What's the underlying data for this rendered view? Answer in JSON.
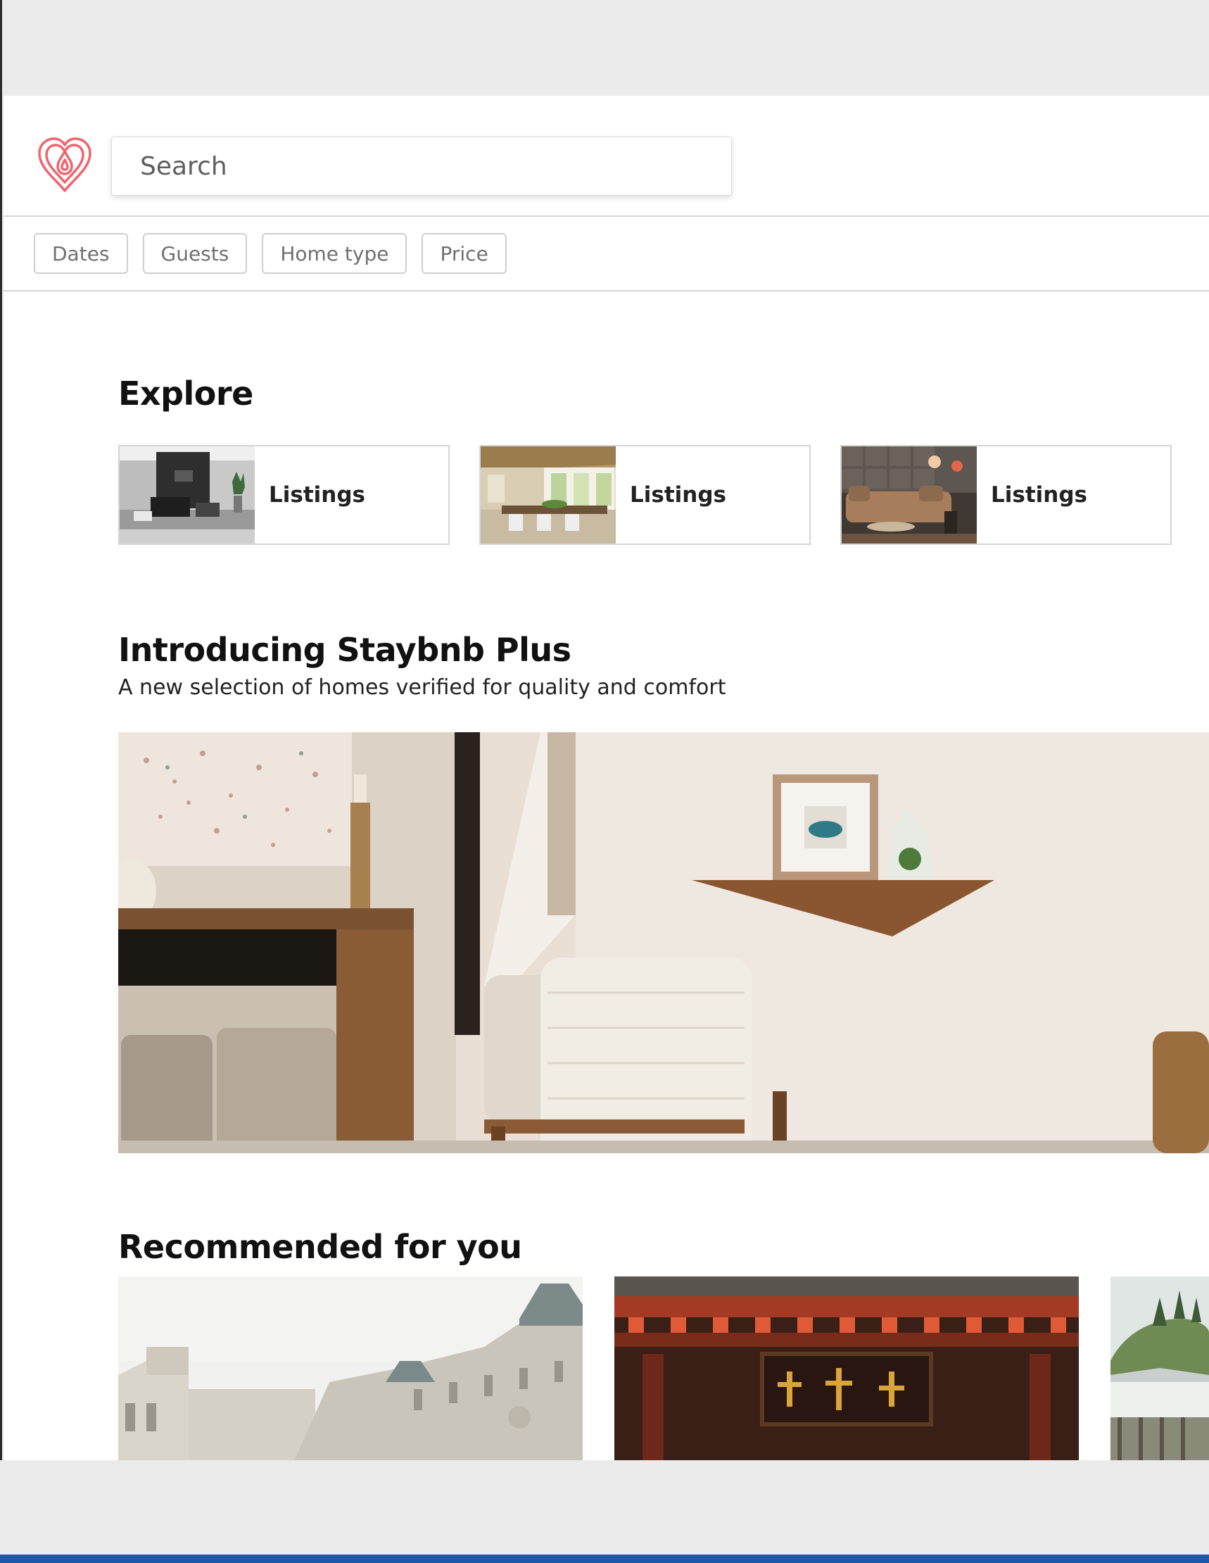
{
  "search": {
    "placeholder": "Search"
  },
  "filters": [
    {
      "label": "Dates"
    },
    {
      "label": "Guests"
    },
    {
      "label": "Home type"
    },
    {
      "label": "Price"
    }
  ],
  "explore": {
    "title": "Explore",
    "cards": [
      {
        "label": "Listings"
      },
      {
        "label": "Listings"
      },
      {
        "label": "Listings"
      }
    ]
  },
  "plus": {
    "title": "Introducing Staybnb Plus",
    "subtitle": "A new selection of homes verified for quality and comfort"
  },
  "recommended": {
    "title": "Recommended for you"
  },
  "colors": {
    "brand": "#f0646e",
    "chip_border": "#cfcfcf",
    "divider": "#d6d6d6",
    "chrome": "#ebebeb"
  },
  "icons": {
    "logo": "heart-drop-logo-icon"
  }
}
